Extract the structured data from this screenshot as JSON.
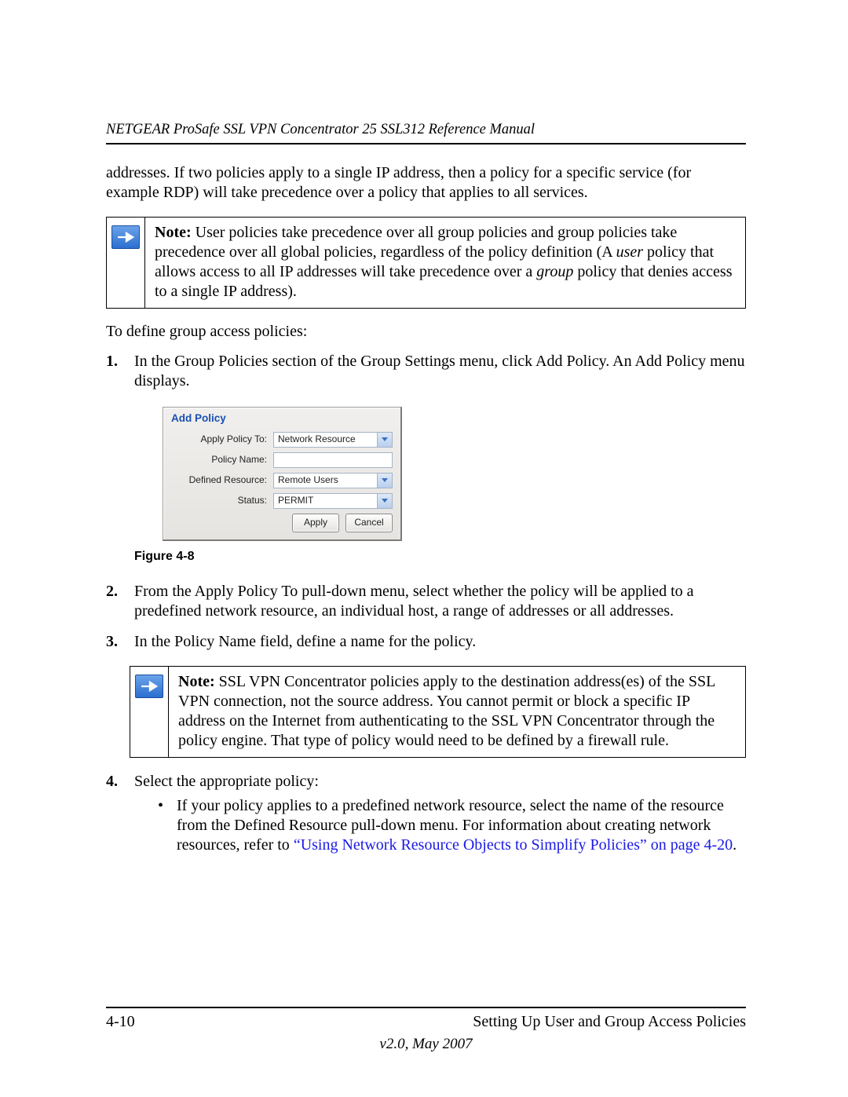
{
  "header": {
    "title": "NETGEAR ProSafe SSL VPN Concentrator 25 SSL312 Reference Manual"
  },
  "intro_para": "addresses. If two policies apply to a single IP address, then a policy for a specific service (for example RDP) will take precedence over a policy that applies to all services.",
  "note1": {
    "label": "Note:",
    "t1": " User policies take precedence over all group policies and group policies take precedence over all global policies, regardless of the policy definition (A ",
    "i1": "user",
    "t2": " policy that allows access to all IP addresses will take precedence over a ",
    "i2": "group",
    "t3": " policy that denies access to a single IP address)."
  },
  "lead_in": "To define group access policies:",
  "steps": {
    "s1": "In the Group Policies section of the Group Settings menu, click Add Policy. An Add Policy menu displays.",
    "s2": "From the Apply Policy To pull-down menu, select whether the policy will be applied to a predefined network resource, an individual host, a range of addresses or all addresses.",
    "s3": "In the Policy Name field, define a name for the policy.",
    "s4": "Select the appropriate policy:"
  },
  "dialog": {
    "title": "Add Policy",
    "labels": {
      "apply_to": "Apply Policy To:",
      "policy_name": "Policy Name:",
      "defined_resource": "Defined Resource:",
      "status": "Status:"
    },
    "values": {
      "apply_to": "Network Resource",
      "policy_name": "",
      "defined_resource": "Remote Users",
      "status": "PERMIT"
    },
    "buttons": {
      "apply": "Apply",
      "cancel": "Cancel"
    }
  },
  "figure_label": "Figure 4-8",
  "note2": {
    "label": "Note:",
    "body": " SSL VPN Concentrator policies apply to the destination address(es) of the SSL VPN connection, not the source address. You cannot permit or block a specific IP address on the Internet from authenticating to the SSL VPN Concentrator through the policy engine. That type of policy would need to be defined by a firewall rule."
  },
  "bullet1": {
    "t1": "If your policy applies to a predefined network resource, select the name of the resource from the Defined Resource pull-down menu. For information about creating network resources, refer to ",
    "link": "“Using Network Resource Objects to Simplify Policies” on page 4-20",
    "t2": "."
  },
  "footer": {
    "page": "4-10",
    "section": "Setting Up User and Group Access Policies",
    "version": "v2.0, May 2007"
  },
  "nums": {
    "n1": "1.",
    "n2": "2.",
    "n3": "3.",
    "n4": "4."
  }
}
